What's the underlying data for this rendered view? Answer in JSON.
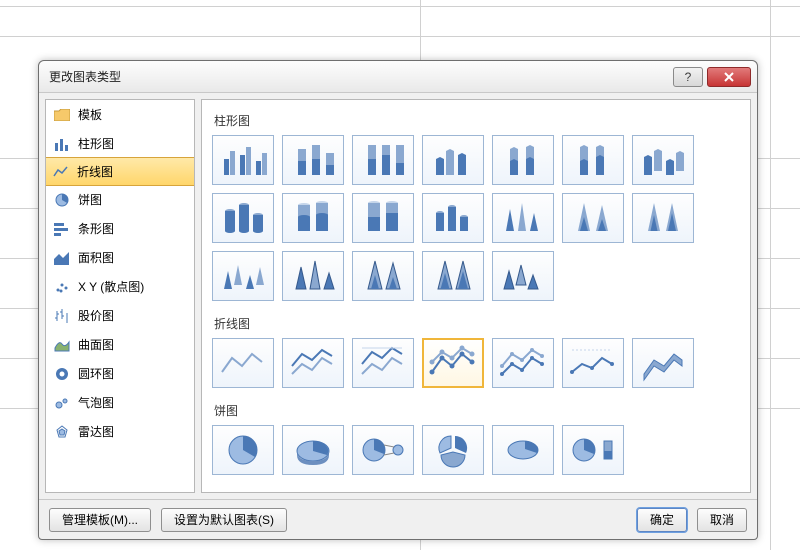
{
  "dialog": {
    "title": "更改图表类型",
    "help_tooltip": "帮助",
    "close_tooltip": "关闭"
  },
  "sidebar": {
    "selected_index": 2,
    "items": [
      {
        "label": "模板",
        "icon": "folder-icon"
      },
      {
        "label": "柱形图",
        "icon": "column-chart-icon"
      },
      {
        "label": "折线图",
        "icon": "line-chart-icon"
      },
      {
        "label": "饼图",
        "icon": "pie-chart-icon"
      },
      {
        "label": "条形图",
        "icon": "bar-chart-icon"
      },
      {
        "label": "面积图",
        "icon": "area-chart-icon"
      },
      {
        "label": "X Y (散点图)",
        "icon": "scatter-chart-icon"
      },
      {
        "label": "股价图",
        "icon": "stock-chart-icon"
      },
      {
        "label": "曲面图",
        "icon": "surface-chart-icon"
      },
      {
        "label": "圆环图",
        "icon": "doughnut-chart-icon"
      },
      {
        "label": "气泡图",
        "icon": "bubble-chart-icon"
      },
      {
        "label": "雷达图",
        "icon": "radar-chart-icon"
      }
    ]
  },
  "sections": {
    "column": {
      "label": "柱形图"
    },
    "line": {
      "label": "折线图"
    },
    "pie": {
      "label": "饼图"
    }
  },
  "thumbs": {
    "column_count": 19,
    "line_count": 7,
    "line_selected_index": 3,
    "pie_count": 6
  },
  "footer": {
    "manage_templates": "管理模板(M)...",
    "set_default": "设置为默认图表(S)",
    "ok": "确定",
    "cancel": "取消"
  }
}
